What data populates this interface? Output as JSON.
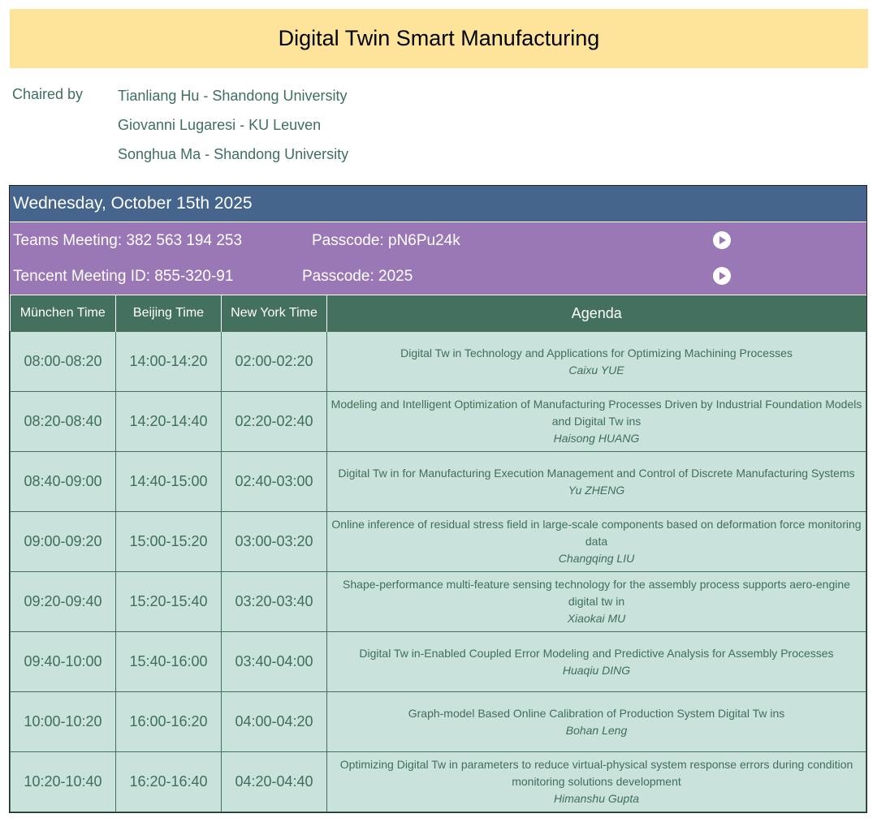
{
  "title": "Digital Twin Smart Manufacturing",
  "chairs": {
    "label": "Chaired by",
    "names": [
      "Tianliang Hu - Shandong University",
      "Giovanni Lugaresi - KU Leuven",
      "Songhua Ma - Shandong University"
    ]
  },
  "day": "Wednesday, October 15th 2025",
  "meetings": [
    {
      "label": "Teams Meeting: 382 563 194 253",
      "passcode": "Passcode: pN6Pu24k",
      "icon": "play-circle-icon"
    },
    {
      "label": "Tencent Meeting ID: 855-320-91",
      "passcode": "Passcode: 2025",
      "icon": "play-circle-icon"
    }
  ],
  "columns": [
    "München Time",
    "Beijing Time",
    "New York Time",
    "Agenda"
  ],
  "rows": [
    {
      "munich": "08:00-08:20",
      "beijing": "14:00-14:20",
      "newyork": "02:00-02:20",
      "title": "Digital Tw in Technology and Applications for Optimizing Machining Processes",
      "speaker": "Caixu YUE"
    },
    {
      "munich": "08:20-08:40",
      "beijing": "14:20-14:40",
      "newyork": "02:20-02:40",
      "title": "Modeling and Intelligent Optimization of Manufacturing Processes Driven by Industrial Foundation Models and Digital Tw ins",
      "speaker": "Haisong HUANG"
    },
    {
      "munich": "08:40-09:00",
      "beijing": "14:40-15:00",
      "newyork": "02:40-03:00",
      "title": "Digital Tw in for Manufacturing Execution Management and Control of Discrete Manufacturing Systems",
      "speaker": "Yu ZHENG"
    },
    {
      "munich": "09:00-09:20",
      "beijing": "15:00-15:20",
      "newyork": "03:00-03:20",
      "title": "Online inference of residual stress field in large-scale components based on deformation force monitoring data",
      "speaker": "Changqing LIU"
    },
    {
      "munich": "09:20-09:40",
      "beijing": "15:20-15:40",
      "newyork": "03:20-03:40",
      "title": "Shape-performance multi-feature sensing technology for the assembly process supports aero-engine digital tw in",
      "speaker": "Xiaokai MU"
    },
    {
      "munich": "09:40-10:00",
      "beijing": "15:40-16:00",
      "newyork": "03:40-04:00",
      "title": "Digital Tw in-Enabled Coupled Error Modeling and Predictive Analysis for Assembly Processes",
      "speaker": "Huaqiu DING"
    },
    {
      "munich": "10:00-10:20",
      "beijing": "16:00-16:20",
      "newyork": "04:00-04:20",
      "title": "Graph-model Based Online Calibration of Production System Digital Tw ins",
      "speaker": "Bohan Leng"
    },
    {
      "munich": "10:20-10:40",
      "beijing": "16:20-16:40",
      "newyork": "04:20-04:40",
      "title": "Optimizing Digital Tw in parameters to reduce virtual-physical system response errors during condition monitoring solutions development",
      "speaker": "Himanshu Gupta"
    }
  ],
  "colors": {
    "title_bg": "#fde49a",
    "day_bg": "#46658c",
    "meeting_bg": "#9a78b5",
    "header_bg": "#44705e",
    "cell_bg": "#c9e2db",
    "text_green": "#3f6f5a"
  }
}
